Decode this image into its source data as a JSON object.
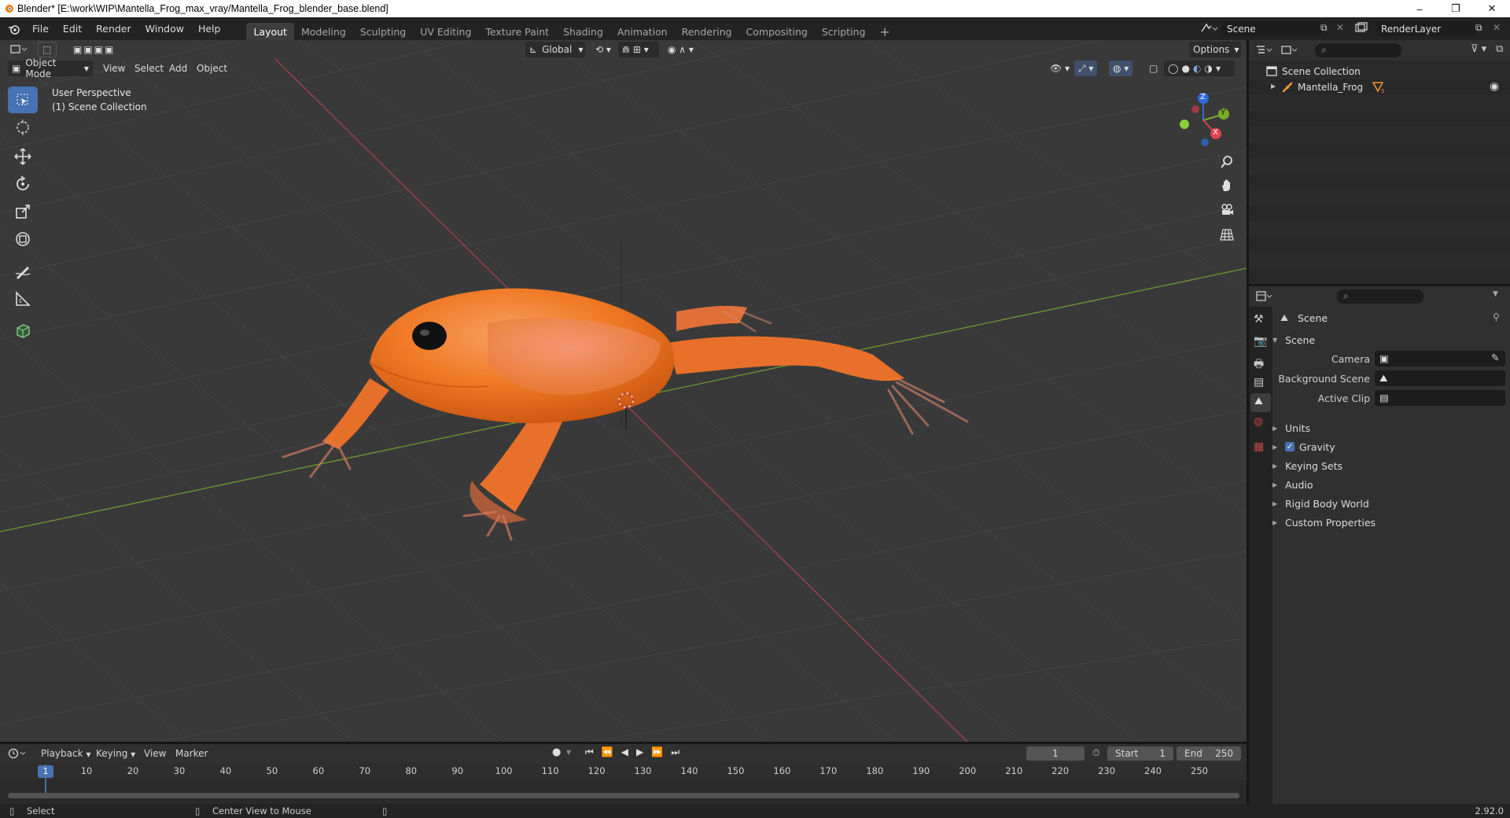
{
  "window": {
    "title": "Blender* [E:\\work\\WIP\\Mantella_Frog_max_vray/Mantella_Frog_blender_base.blend]",
    "controls": [
      "–",
      "❐",
      "✕"
    ]
  },
  "menu": [
    "File",
    "Edit",
    "Render",
    "Window",
    "Help"
  ],
  "workspaces": [
    {
      "label": "Layout",
      "active": true
    },
    {
      "label": "Modeling"
    },
    {
      "label": "Sculpting"
    },
    {
      "label": "UV Editing"
    },
    {
      "label": "Texture Paint"
    },
    {
      "label": "Shading"
    },
    {
      "label": "Animation"
    },
    {
      "label": "Rendering"
    },
    {
      "label": "Compositing"
    },
    {
      "label": "Scripting"
    }
  ],
  "add_workspace": "+",
  "scene_field": "Scene",
  "renderlayer_field": "RenderLayer",
  "viewport": {
    "transform_orientation": "Global",
    "options_label": "Options",
    "mode": "Object Mode",
    "header_menus": [
      "View",
      "Select",
      "Add",
      "Object"
    ],
    "overlay_line1": "User Perspective",
    "overlay_line2": "(1) Scene Collection",
    "gizmo": {
      "x": "X",
      "y": "Y",
      "z": "Z"
    },
    "colors": {
      "background": "#393939",
      "x_axis": "#a8404a",
      "y_axis": "#6f9a2e",
      "frog": "#f07a26"
    }
  },
  "outliner": {
    "root": "Scene Collection",
    "items": [
      {
        "label": "Mantella_Frog"
      }
    ]
  },
  "properties": {
    "context": "Scene",
    "panel_scene": "Scene",
    "fields": [
      {
        "label": "Camera",
        "value": ""
      },
      {
        "label": "Background Scene",
        "value": ""
      },
      {
        "label": "Active Clip",
        "value": ""
      }
    ],
    "panels": [
      {
        "label": "Units",
        "checkbox": false
      },
      {
        "label": "Gravity",
        "checkbox": true
      },
      {
        "label": "Keying Sets",
        "checkbox": false
      },
      {
        "label": "Audio",
        "checkbox": false
      },
      {
        "label": "Rigid Body World",
        "checkbox": false
      },
      {
        "label": "Custom Properties",
        "checkbox": false
      }
    ]
  },
  "timeline": {
    "menus": [
      "Playback",
      "Keying",
      "View",
      "Marker"
    ],
    "current_frame": "1",
    "start_label": "Start",
    "start_value": "1",
    "end_label": "End",
    "end_value": "250",
    "ruler": [
      "1",
      "10",
      "20",
      "30",
      "40",
      "50",
      "60",
      "70",
      "80",
      "90",
      "100",
      "110",
      "120",
      "130",
      "140",
      "150",
      "160",
      "170",
      "180",
      "190",
      "200",
      "210",
      "220",
      "230",
      "240",
      "250"
    ]
  },
  "statusbar": {
    "select": "Select",
    "center_view": "Center View to Mouse",
    "version": "2.92.0"
  }
}
